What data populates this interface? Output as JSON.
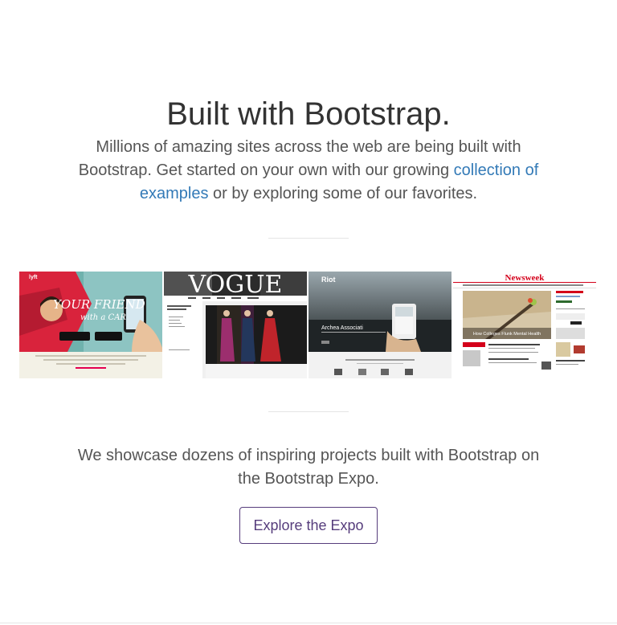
{
  "section": {
    "title": "Built with Bootstrap.",
    "lead_before_link": "Millions of amazing sites across the web are being built with Bootstrap. Get started on your own with our growing ",
    "lead_link": "collection of examples",
    "lead_after_link": " or by exploring some of our favorites."
  },
  "gallery": {
    "items": [
      {
        "logo": "lyft",
        "headline_1": "YOUR FRIEND",
        "headline_2": "with a CAR"
      },
      {
        "logo": "VOGUE"
      },
      {
        "logo": "Riot",
        "caption": "Archea Associati"
      },
      {
        "logo": "Newsweek",
        "caption": "How Colleges Flunk Mental Health"
      }
    ]
  },
  "showcase": {
    "text": "We showcase dozens of inspiring projects built with Bootstrap on the Bootstrap Expo.",
    "button_label": "Explore the Expo"
  },
  "colors": {
    "link": "#337ab7",
    "brand_purple": "#563d7c",
    "lyft_pink": "#e5004f",
    "newsweek_red": "#d4001a"
  }
}
